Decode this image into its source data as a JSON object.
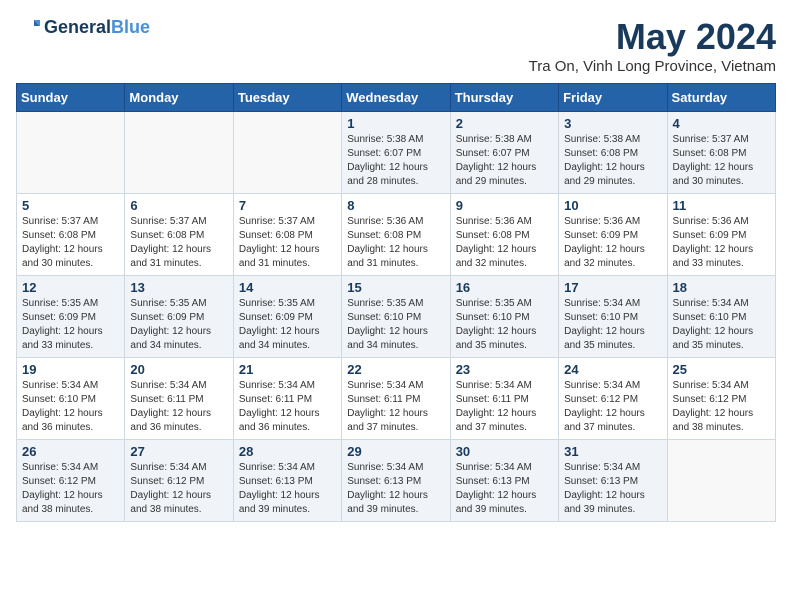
{
  "logo": {
    "line1": "General",
    "line2": "Blue"
  },
  "title": "May 2024",
  "subtitle": "Tra On, Vinh Long Province, Vietnam",
  "weekdays": [
    "Sunday",
    "Monday",
    "Tuesday",
    "Wednesday",
    "Thursday",
    "Friday",
    "Saturday"
  ],
  "weeks": [
    [
      {
        "day": "",
        "info": ""
      },
      {
        "day": "",
        "info": ""
      },
      {
        "day": "",
        "info": ""
      },
      {
        "day": "1",
        "info": "Sunrise: 5:38 AM\nSunset: 6:07 PM\nDaylight: 12 hours\nand 28 minutes."
      },
      {
        "day": "2",
        "info": "Sunrise: 5:38 AM\nSunset: 6:07 PM\nDaylight: 12 hours\nand 29 minutes."
      },
      {
        "day": "3",
        "info": "Sunrise: 5:38 AM\nSunset: 6:08 PM\nDaylight: 12 hours\nand 29 minutes."
      },
      {
        "day": "4",
        "info": "Sunrise: 5:37 AM\nSunset: 6:08 PM\nDaylight: 12 hours\nand 30 minutes."
      }
    ],
    [
      {
        "day": "5",
        "info": "Sunrise: 5:37 AM\nSunset: 6:08 PM\nDaylight: 12 hours\nand 30 minutes."
      },
      {
        "day": "6",
        "info": "Sunrise: 5:37 AM\nSunset: 6:08 PM\nDaylight: 12 hours\nand 31 minutes."
      },
      {
        "day": "7",
        "info": "Sunrise: 5:37 AM\nSunset: 6:08 PM\nDaylight: 12 hours\nand 31 minutes."
      },
      {
        "day": "8",
        "info": "Sunrise: 5:36 AM\nSunset: 6:08 PM\nDaylight: 12 hours\nand 31 minutes."
      },
      {
        "day": "9",
        "info": "Sunrise: 5:36 AM\nSunset: 6:08 PM\nDaylight: 12 hours\nand 32 minutes."
      },
      {
        "day": "10",
        "info": "Sunrise: 5:36 AM\nSunset: 6:09 PM\nDaylight: 12 hours\nand 32 minutes."
      },
      {
        "day": "11",
        "info": "Sunrise: 5:36 AM\nSunset: 6:09 PM\nDaylight: 12 hours\nand 33 minutes."
      }
    ],
    [
      {
        "day": "12",
        "info": "Sunrise: 5:35 AM\nSunset: 6:09 PM\nDaylight: 12 hours\nand 33 minutes."
      },
      {
        "day": "13",
        "info": "Sunrise: 5:35 AM\nSunset: 6:09 PM\nDaylight: 12 hours\nand 34 minutes."
      },
      {
        "day": "14",
        "info": "Sunrise: 5:35 AM\nSunset: 6:09 PM\nDaylight: 12 hours\nand 34 minutes."
      },
      {
        "day": "15",
        "info": "Sunrise: 5:35 AM\nSunset: 6:10 PM\nDaylight: 12 hours\nand 34 minutes."
      },
      {
        "day": "16",
        "info": "Sunrise: 5:35 AM\nSunset: 6:10 PM\nDaylight: 12 hours\nand 35 minutes."
      },
      {
        "day": "17",
        "info": "Sunrise: 5:34 AM\nSunset: 6:10 PM\nDaylight: 12 hours\nand 35 minutes."
      },
      {
        "day": "18",
        "info": "Sunrise: 5:34 AM\nSunset: 6:10 PM\nDaylight: 12 hours\nand 35 minutes."
      }
    ],
    [
      {
        "day": "19",
        "info": "Sunrise: 5:34 AM\nSunset: 6:10 PM\nDaylight: 12 hours\nand 36 minutes."
      },
      {
        "day": "20",
        "info": "Sunrise: 5:34 AM\nSunset: 6:11 PM\nDaylight: 12 hours\nand 36 minutes."
      },
      {
        "day": "21",
        "info": "Sunrise: 5:34 AM\nSunset: 6:11 PM\nDaylight: 12 hours\nand 36 minutes."
      },
      {
        "day": "22",
        "info": "Sunrise: 5:34 AM\nSunset: 6:11 PM\nDaylight: 12 hours\nand 37 minutes."
      },
      {
        "day": "23",
        "info": "Sunrise: 5:34 AM\nSunset: 6:11 PM\nDaylight: 12 hours\nand 37 minutes."
      },
      {
        "day": "24",
        "info": "Sunrise: 5:34 AM\nSunset: 6:12 PM\nDaylight: 12 hours\nand 37 minutes."
      },
      {
        "day": "25",
        "info": "Sunrise: 5:34 AM\nSunset: 6:12 PM\nDaylight: 12 hours\nand 38 minutes."
      }
    ],
    [
      {
        "day": "26",
        "info": "Sunrise: 5:34 AM\nSunset: 6:12 PM\nDaylight: 12 hours\nand 38 minutes."
      },
      {
        "day": "27",
        "info": "Sunrise: 5:34 AM\nSunset: 6:12 PM\nDaylight: 12 hours\nand 38 minutes."
      },
      {
        "day": "28",
        "info": "Sunrise: 5:34 AM\nSunset: 6:13 PM\nDaylight: 12 hours\nand 39 minutes."
      },
      {
        "day": "29",
        "info": "Sunrise: 5:34 AM\nSunset: 6:13 PM\nDaylight: 12 hours\nand 39 minutes."
      },
      {
        "day": "30",
        "info": "Sunrise: 5:34 AM\nSunset: 6:13 PM\nDaylight: 12 hours\nand 39 minutes."
      },
      {
        "day": "31",
        "info": "Sunrise: 5:34 AM\nSunset: 6:13 PM\nDaylight: 12 hours\nand 39 minutes."
      },
      {
        "day": "",
        "info": ""
      }
    ]
  ]
}
